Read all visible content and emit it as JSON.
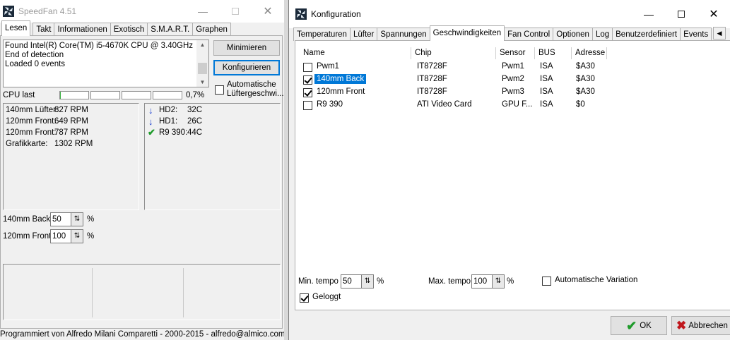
{
  "speedfan": {
    "title": "SpeedFan 4.51",
    "tabs": [
      "Lesen",
      "Takt",
      "Informationen",
      "Exotisch",
      "S.M.A.R.T.",
      "Graphen"
    ],
    "log_lines": [
      "Found Intel(R) Core(TM) i5-4670K CPU @ 3.40GHz",
      "End of detection",
      "Loaded 0 events"
    ],
    "minimize_label": "Minimieren",
    "configure_label": "Konfigurieren",
    "auto_fan_label_1": "Automatische",
    "auto_fan_label_2": "Lüftergeschwi...",
    "cpu_label": "CPU last",
    "cpu_percent": "0,7%",
    "cpu_usage_fraction": 0.007,
    "fan_speeds": [
      {
        "name": "140mm Lüfter:",
        "value": "827 RPM"
      },
      {
        "name": "120mm Front:",
        "value": "649 RPM"
      },
      {
        "name": "120mm Front:",
        "value": "787 RPM"
      },
      {
        "name": "Grafikkarte:",
        "value": "1302 RPM"
      }
    ],
    "temps": [
      {
        "name": "HD2:",
        "value": "32C",
        "icon": "arrow-down-icon"
      },
      {
        "name": "HD1:",
        "value": "26C",
        "icon": "arrow-down-icon"
      },
      {
        "name": "R9 390:",
        "value": "44C",
        "icon": "checkmark-icon"
      }
    ],
    "speed_controls": [
      {
        "label": "140mm Back:",
        "value": "50",
        "unit": "%"
      },
      {
        "label": "120mm Front:",
        "value": "100",
        "unit": "%"
      }
    ],
    "footer": "Programmiert von Alfredo Milani Comparetti - 2000-2015 - alfredo@almico.com"
  },
  "config": {
    "title": "Konfiguration",
    "tabs": [
      "Temperaturen",
      "Lüfter",
      "Spannungen",
      "Geschwindigkeiten",
      "Fan Control",
      "Optionen",
      "Log",
      "Benutzerdefiniert",
      "Events"
    ],
    "active_tab": "Geschwindigkeiten",
    "columns": [
      "Name",
      "Chip",
      "Sensor",
      "BUS",
      "Adresse"
    ],
    "rows": [
      {
        "checked": false,
        "name": "Pwm1",
        "chip": "IT8728F",
        "sensor": "Pwm1",
        "bus": "ISA",
        "address": "$A30",
        "selected": false
      },
      {
        "checked": true,
        "name": "140mm Back",
        "chip": "IT8728F",
        "sensor": "Pwm2",
        "bus": "ISA",
        "address": "$A30",
        "selected": true
      },
      {
        "checked": true,
        "name": "120mm Front",
        "chip": "IT8728F",
        "sensor": "Pwm3",
        "bus": "ISA",
        "address": "$A30",
        "selected": false
      },
      {
        "checked": false,
        "name": "R9 390",
        "chip": "ATI Video Card",
        "sensor": "GPU F...",
        "bus": "ISA",
        "address": "$0",
        "selected": false
      }
    ],
    "min_tempo_label": "Min. tempo",
    "min_tempo_value": "50",
    "max_tempo_label": "Max. tempo",
    "max_tempo_value": "100",
    "percent_unit": "%",
    "auto_variation_label": "Automatische Variation",
    "auto_variation_checked": false,
    "logged_label": "Geloggt",
    "logged_checked": true,
    "ok_label": "OK",
    "cancel_label": "Abbrechen"
  },
  "colors": {
    "selection": "#0078d7",
    "ok_check": "#1e9b2a",
    "cancel_x": "#c0161c",
    "temp_arrow": "#1a3fd0"
  }
}
